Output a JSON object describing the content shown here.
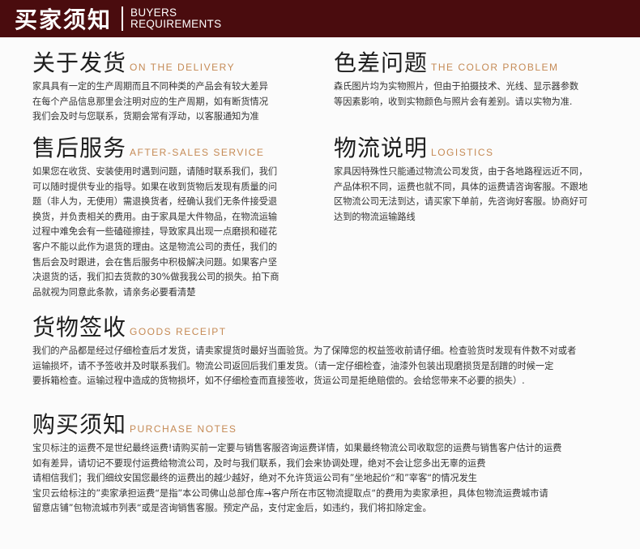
{
  "banner": {
    "title_cn": "买家须知",
    "title_en_line1": "BUYERS",
    "title_en_line2": "REQUIREMENTS"
  },
  "sections": {
    "delivery": {
      "title_cn": "关于发货",
      "title_en": "ON THE DELIVERY",
      "lines": [
        "家具具有一定的生产周期而且不同种类的产品会有较大差异",
        "在每个产品信息那里会注明对应的生产周期，如有断货情况",
        "我们会及时与您联系，货期会常有浮动，以客服通知为准"
      ]
    },
    "color": {
      "title_cn": "色差问题",
      "title_en": "THE COLOR PROBLEM",
      "lines": [
        "森氏图片均为实物照片，但由于拍摄技术、光线、显示器参数",
        "等因素影响，收到实物颜色与照片会有差别。请以实物为准."
      ]
    },
    "after_sales": {
      "title_cn": "售后服务",
      "title_en": "AFTER-SALES SERVICE",
      "lines": [
        "如果您在收货、安装使用时遇到问题，请随时联系我们，我们",
        "可以随时提供专业的指导。如果在收到货物后发现有质量的问",
        "题（非人为，无使用）需退换货者，经确认我们无条件接受退",
        "换货，并负责相关的费用。由于家具是大件物品，在物流运输",
        "过程中难免会有一些磕碰擦挂，导致家具出现一点磨损和碰花",
        "客户不能以此作为退货的理由。这是物流公司的责任，我们的",
        "售后会及时跟进，会在售后服务中积极解决问题。如果客户坚",
        "决退货的话，我们扣去货款的30%做我我公司的损失。拍下商",
        "品就视为同意此条款，请亲务必要看清楚"
      ]
    },
    "logistics": {
      "title_cn": "物流说明",
      "title_en": "LOGISTICS",
      "lines": [
        "家具因特殊性只能通过物流公司发货，由于各地路程远近不同，",
        "产品体积不同，运费也就不同，具体的运费请咨询客服。不跟地",
        "区物流公司无法到达，请买家下单前，先咨询好客服。协商好可",
        "达到的物流运输路线"
      ]
    },
    "receipt": {
      "title_cn": "货物签收",
      "title_en": "GOODS RECEIPT",
      "lines": [
        "我们的产品都是经过仔细检查后才发货，请卖家提货时最好当面验货。为了保障您的权益签收前请仔细。检查验货时发现有件数不对或者",
        "运输损坏，请不予签收并及时联系我们。物流公司返回后我们重发货。（请一定仔细检查，油漆外包装出现磨损货是刮蹭的时候一定",
        "要拆箱检查。运输过程中造成的货物损坏，如不仔细检查而直接签收，货运公司是拒绝赔偿的。会给您带来不必要的损失）."
      ]
    },
    "purchase": {
      "title_cn": "购买须知",
      "title_en": "PURCHASE NOTES",
      "lines": [
        "宝贝标注的运费不是世纪最终运费!请购买前一定要与销售客服咨询运费详情，如果最终物流公司收取您的运费与销售客户估计的运费",
        "如有差异，请切记不要现付运费给物流公司，及时与我们联系，我们会来协调处理，绝对不会让您多出无辜的运费",
        "请相信我们；我们细纹安国您最终的运费出的越少越好，绝对不允许货运公司有”坐地起价“和”宰客“的情况发生",
        "宝贝云给标注的”卖家承担运费“是指”本公司佛山总部仓库→客户所在市区物流提取点“的费用为卖家承担，具体包物流运费城市请",
        "留意店铺”包物流城市列表“或是咨询销售客服。预定产品，支付定金后，如违约，我们将扣除定金。"
      ]
    }
  }
}
